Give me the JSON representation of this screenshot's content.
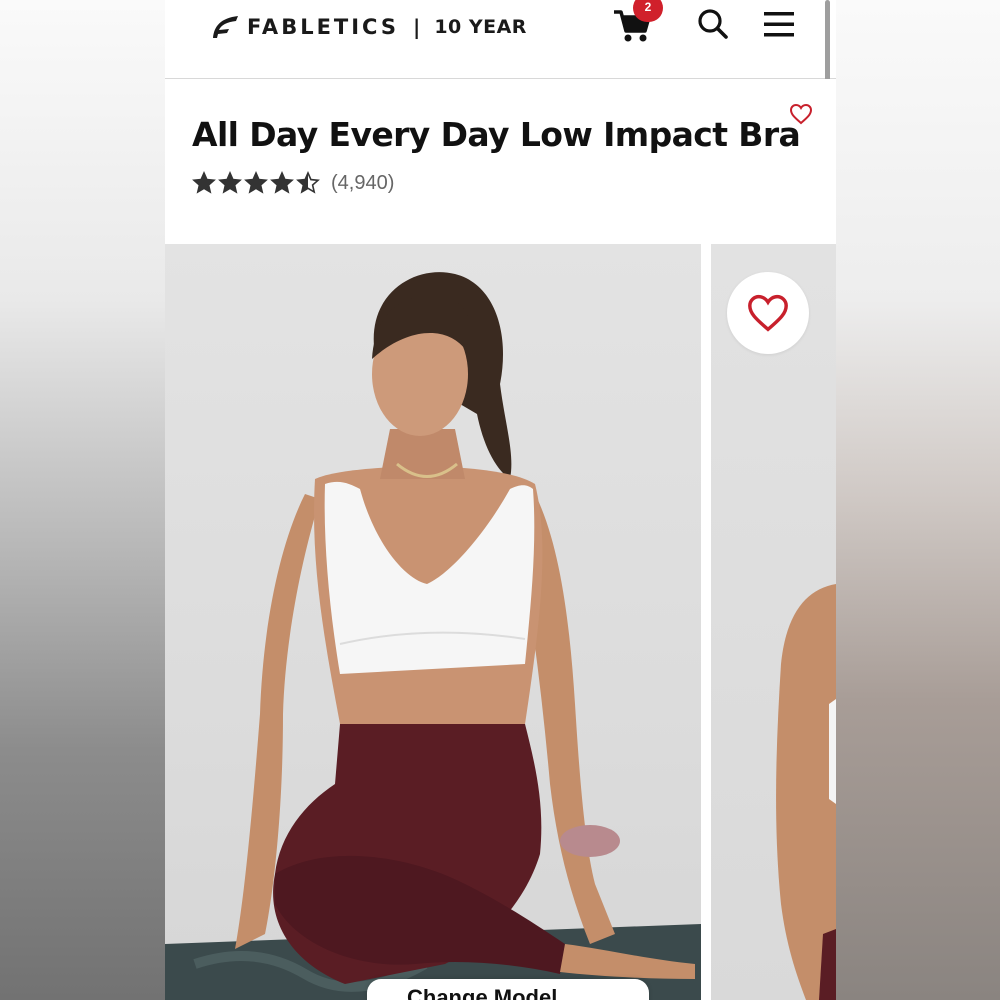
{
  "header": {
    "brand": "FABLETICS",
    "separator": "|",
    "anniversary": "10 YEAR",
    "cart_count": "2"
  },
  "product": {
    "title": "All Day Every Day Low Impact Bra",
    "rating": 4.5,
    "review_count": "(4,940)"
  },
  "gallery": {
    "change_model_label": "Change Model"
  },
  "colors": {
    "accent_red": "#d0202b",
    "heart_red": "#c8202c",
    "text_dark": "#111111",
    "leggings_burgundy": "#5a1d24"
  },
  "icons": {
    "logo": "fabletics-logo-icon",
    "cart": "cart-icon",
    "search": "search-icon",
    "menu": "hamburger-menu-icon",
    "wishlist": "heart-icon",
    "star": "star-icon"
  }
}
